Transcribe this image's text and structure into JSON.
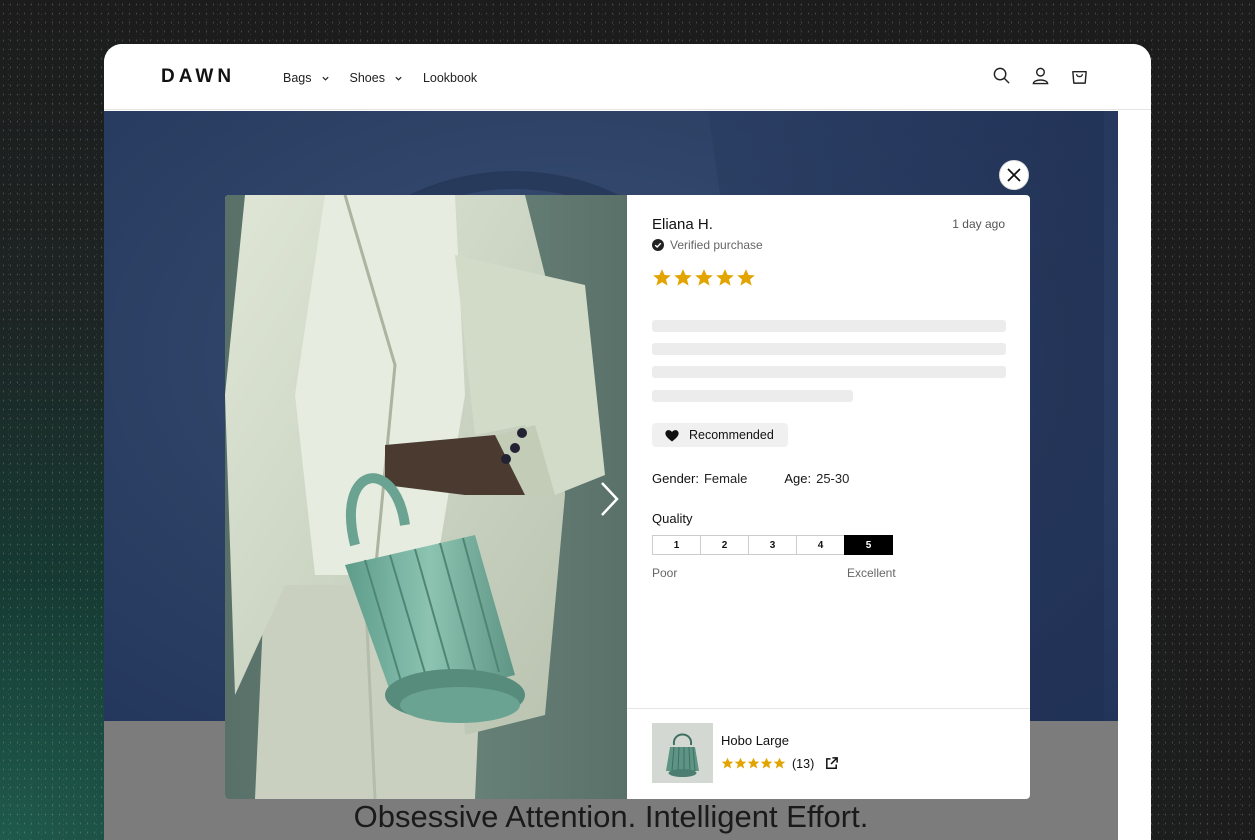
{
  "store": {
    "logo": "DAWN",
    "nav": [
      {
        "label": "Bags",
        "has_dropdown": true
      },
      {
        "label": "Shoes",
        "has_dropdown": true
      },
      {
        "label": "Lookbook",
        "has_dropdown": false
      }
    ],
    "header_icons": [
      "search-icon",
      "account-icon",
      "cart-icon"
    ]
  },
  "hero": {
    "tagline": "Obsessive Attention. Intelligent Effort."
  },
  "review_modal": {
    "reviewer": "Eliana H.",
    "date": "1 day ago",
    "verified_label": "Verified purchase",
    "rating": 5,
    "rating_max": 5,
    "recommended_label": "Recommended",
    "attributes": [
      {
        "key": "Gender:",
        "value": "Female"
      },
      {
        "key": "Age:",
        "value": "25-30"
      }
    ],
    "quality": {
      "label": "Quality",
      "options": [
        "1",
        "2",
        "3",
        "4",
        "5"
      ],
      "selected": "5",
      "min_label": "Poor",
      "max_label": "Excellent"
    },
    "product": {
      "name": "Hobo Large",
      "rating": 5,
      "review_count": "(13)"
    }
  },
  "colors": {
    "star": "#E2A400",
    "hero_blue": "#2f4468",
    "photo_sage": "#6e8a82",
    "bag_mint": "#7fb8a6"
  }
}
